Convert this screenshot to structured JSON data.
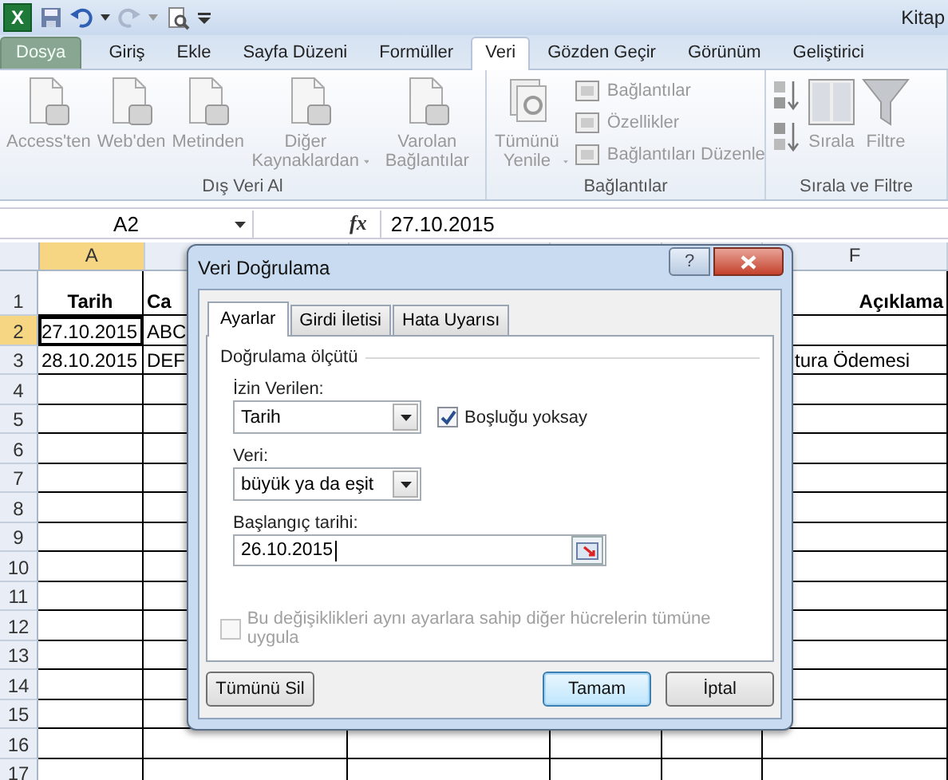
{
  "window": {
    "app_icon": "X",
    "title": "Kitap"
  },
  "tabs": [
    {
      "label": "Dosya",
      "kind": "file",
      "selected": false
    },
    {
      "label": "Giriş",
      "kind": "tab",
      "selected": false
    },
    {
      "label": "Ekle",
      "kind": "tab",
      "selected": false
    },
    {
      "label": "Sayfa Düzeni",
      "kind": "tab",
      "selected": false
    },
    {
      "label": "Formüller",
      "kind": "tab",
      "selected": false
    },
    {
      "label": "Veri",
      "kind": "tab",
      "selected": true
    },
    {
      "label": "Gözden Geçir",
      "kind": "tab",
      "selected": false
    },
    {
      "label": "Görünüm",
      "kind": "tab",
      "selected": false
    },
    {
      "label": "Geliştirici",
      "kind": "tab",
      "selected": false
    }
  ],
  "ribbon": [
    {
      "label": "Dış Veri Al",
      "items": [
        {
          "kind": "large",
          "label": "Access'ten",
          "dropdown": false
        },
        {
          "kind": "large",
          "label": "Web'den",
          "dropdown": false
        },
        {
          "kind": "large",
          "label": "Metinden",
          "dropdown": false
        },
        {
          "kind": "large",
          "label": "Diğer Kaynaklardan",
          "dropdown": true
        },
        {
          "kind": "large",
          "label": "Varolan Bağlantılar",
          "dropdown": false
        }
      ]
    },
    {
      "label": "Bağlantılar",
      "items": [
        {
          "kind": "large",
          "label": "Tümünü Yenile",
          "dropdown": true
        },
        {
          "kind": "stack",
          "labels": [
            "Bağlantılar",
            "Özellikler",
            "Bağlantıları Düzenle"
          ]
        }
      ]
    },
    {
      "label": "Sırala ve Filtre",
      "items": [
        {
          "kind": "sort_pair"
        },
        {
          "kind": "large",
          "label": "Sırala",
          "dropdown": false
        },
        {
          "kind": "large",
          "label": "Filtre",
          "dropdown": false
        }
      ]
    }
  ],
  "formula_bar": {
    "name_box": "A2",
    "function_label": "fx",
    "value": "27.10.2015"
  },
  "sheet": {
    "columns": [
      {
        "label": "A",
        "selected": true
      },
      {},
      {},
      {},
      {},
      {
        "label": "F",
        "selected": false
      }
    ],
    "rows": [
      {
        "header": "1",
        "selected": false,
        "bold": true,
        "cells": [
          "Tarih",
          "Ca",
          null,
          null,
          null,
          "Açıklama"
        ]
      },
      {
        "header": "2",
        "selected": true,
        "bold": false,
        "cells": [
          "27.10.2015",
          "ABC",
          null,
          null,
          null,
          null
        ]
      },
      {
        "header": "3",
        "selected": false,
        "bold": false,
        "cells": [
          "28.10.2015",
          "DEF",
          null,
          null,
          null,
          "tura Ödemesi"
        ]
      },
      {
        "header": "4",
        "selected": false,
        "cells": [
          null,
          null,
          null,
          null,
          null,
          null
        ]
      },
      {
        "header": "5",
        "selected": false,
        "cells": [
          null,
          null,
          null,
          null,
          null,
          null
        ]
      },
      {
        "header": "6",
        "selected": false,
        "cells": [
          null,
          null,
          null,
          null,
          null,
          null
        ]
      },
      {
        "header": "7",
        "selected": false,
        "cells": [
          null,
          null,
          null,
          null,
          null,
          null
        ]
      },
      {
        "header": "8",
        "selected": false,
        "cells": [
          null,
          null,
          null,
          null,
          null,
          null
        ]
      },
      {
        "header": "9",
        "selected": false,
        "cells": [
          null,
          null,
          null,
          null,
          null,
          null
        ]
      },
      {
        "header": "10",
        "selected": false,
        "cells": [
          null,
          null,
          null,
          null,
          null,
          null
        ]
      },
      {
        "header": "11",
        "selected": false,
        "cells": [
          null,
          null,
          null,
          null,
          null,
          null
        ]
      },
      {
        "header": "12",
        "selected": false,
        "cells": [
          null,
          null,
          null,
          null,
          null,
          null
        ]
      },
      {
        "header": "13",
        "selected": false,
        "cells": [
          null,
          null,
          null,
          null,
          null,
          null
        ]
      },
      {
        "header": "14",
        "selected": false,
        "cells": [
          null,
          null,
          null,
          null,
          null,
          null
        ]
      },
      {
        "header": "15",
        "selected": false,
        "cells": [
          null,
          null,
          null,
          null,
          null,
          null
        ]
      },
      {
        "header": "16",
        "selected": false,
        "cells": [
          null,
          null,
          null,
          null,
          null,
          null
        ]
      },
      {
        "header": "17",
        "selected": false,
        "cells": [
          null,
          null,
          null,
          null,
          null,
          null
        ]
      }
    ]
  },
  "dialog": {
    "title": "Veri Doğrulama",
    "help": "?",
    "tabs": [
      {
        "label": "Ayarlar",
        "selected": true
      },
      {
        "label": "Girdi İletisi",
        "selected": false
      },
      {
        "label": "Hata Uyarısı",
        "selected": false
      }
    ],
    "section": "Doğrulama ölçütü",
    "allow": {
      "label": "İzin Verilen:",
      "value": "Tarih"
    },
    "ignore_blank": {
      "label": "Boşluğu yoksay",
      "checked": true
    },
    "data": {
      "label": "Veri:",
      "value": "büyük ya da eşit"
    },
    "start_date": {
      "label": "Başlangıç tarihi:",
      "value": "26.10.2015"
    },
    "apply_all": {
      "label": "Bu değişiklikleri aynı ayarlara sahip diğer hücrelerin tümüne uygula",
      "checked": false,
      "disabled": true
    },
    "buttons": [
      {
        "label": "Tümünü Sil",
        "kind": "clear"
      },
      {
        "label": "Tamam",
        "kind": "default"
      },
      {
        "label": "İptal",
        "kind": "cancel"
      }
    ]
  }
}
